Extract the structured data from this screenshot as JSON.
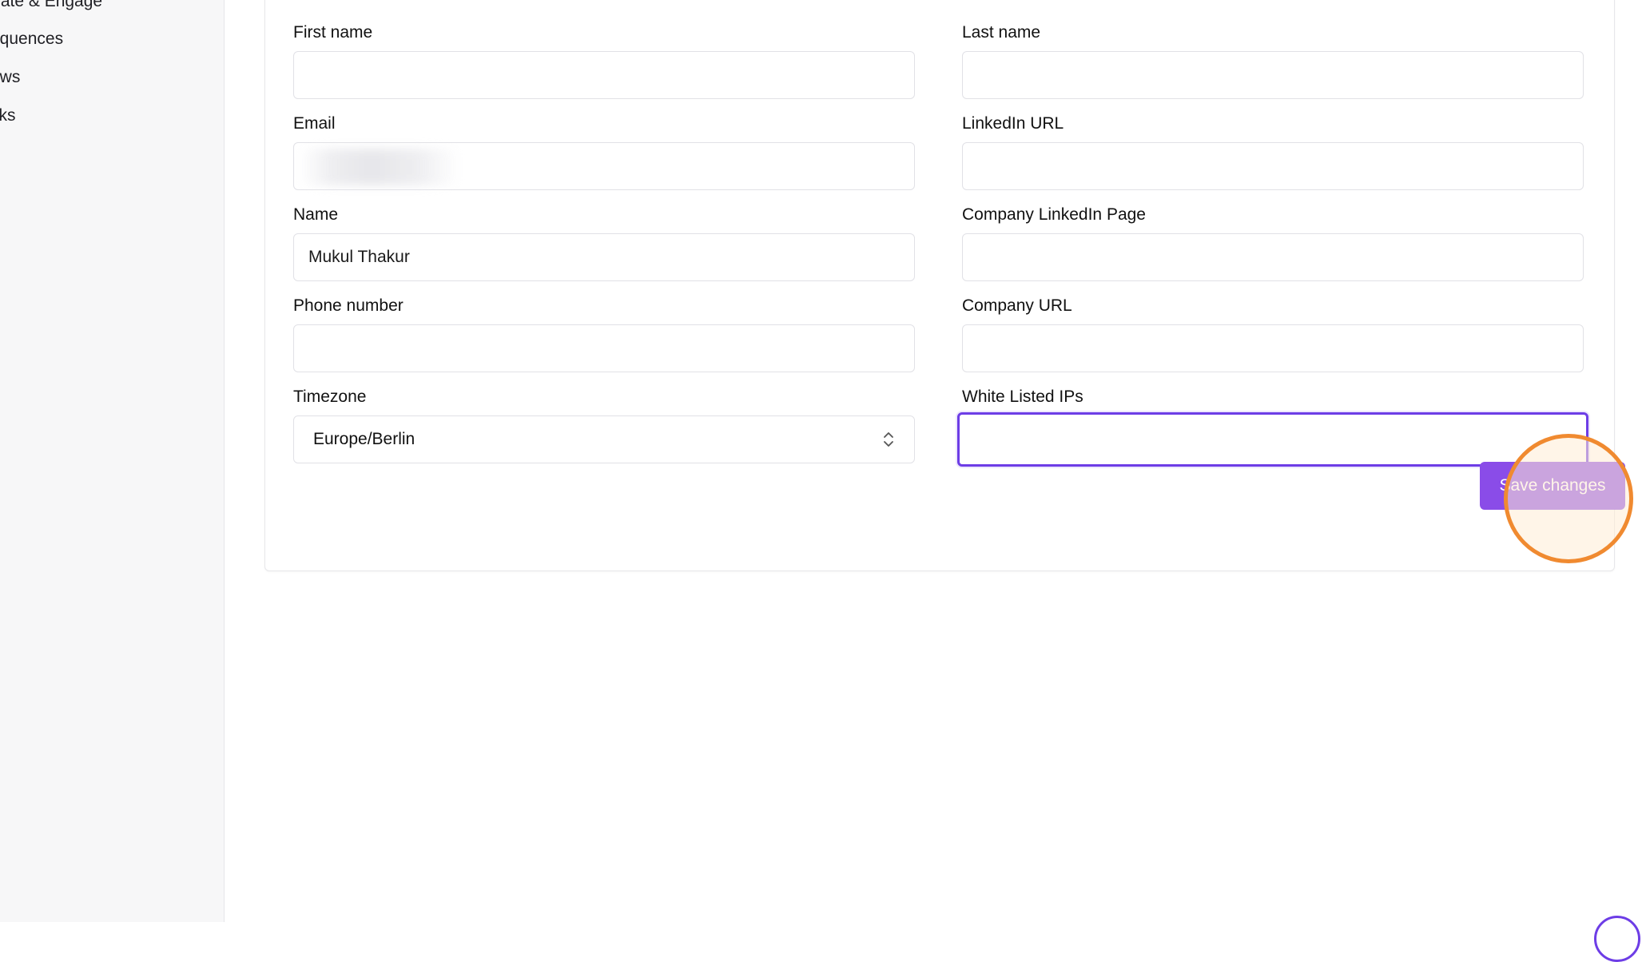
{
  "sidebar": {
    "items": [
      {
        "label": "trate & Engage"
      },
      {
        "label": "equences"
      },
      {
        "label": "ows"
      },
      {
        "label": "sks"
      }
    ]
  },
  "form": {
    "first_name": {
      "label": "First name",
      "value": ""
    },
    "last_name": {
      "label": "Last name",
      "value": ""
    },
    "email": {
      "label": "Email",
      "value": ""
    },
    "linkedin_url": {
      "label": "LinkedIn URL",
      "value": ""
    },
    "name": {
      "label": "Name",
      "value": "Mukul Thakur"
    },
    "company_linkedin_page": {
      "label": "Company LinkedIn Page",
      "value": ""
    },
    "phone_number": {
      "label": "Phone number",
      "value": ""
    },
    "company_url": {
      "label": "Company URL",
      "value": ""
    },
    "timezone": {
      "label": "Timezone",
      "value": "Europe/Berlin"
    },
    "white_listed_ips": {
      "label": "White Listed IPs",
      "value": ""
    }
  },
  "actions": {
    "save_label": "Save changes"
  },
  "colors": {
    "accent": "#8a4ce8",
    "focus_border": "#6d3de6",
    "click_highlight": "#f08a30"
  }
}
